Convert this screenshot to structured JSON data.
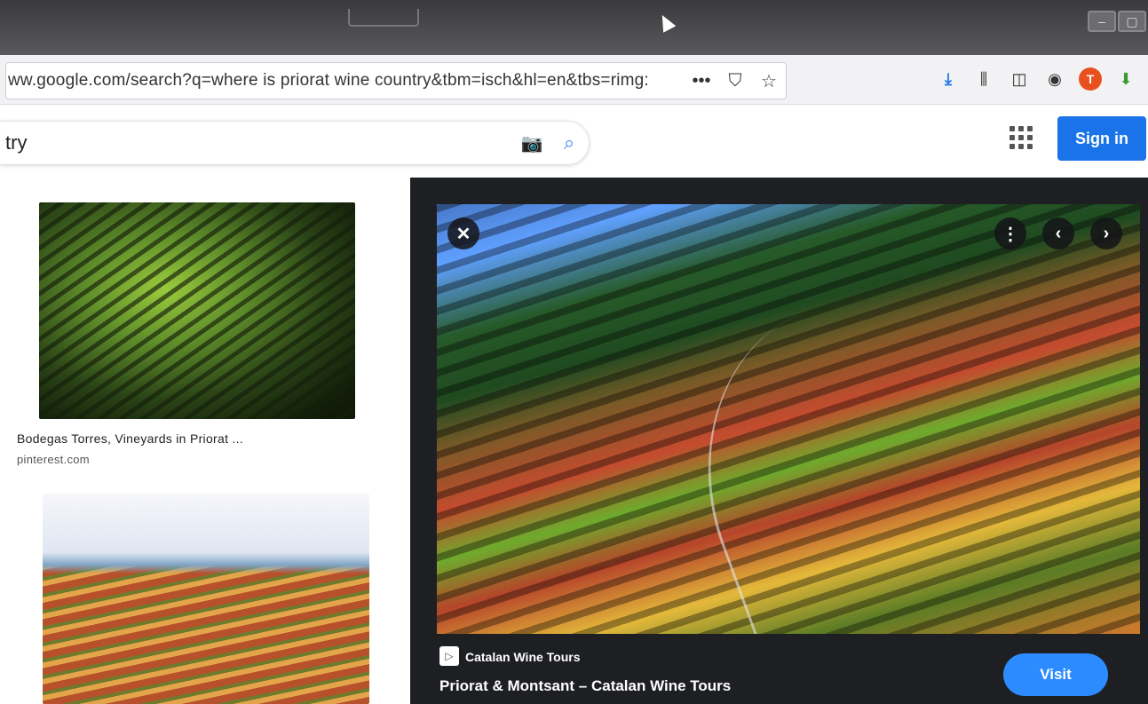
{
  "browser": {
    "url": "ww.google.com/search?q=where is priorat wine country&tbm=isch&hl=en&tbs=rimg:",
    "url_actions": [
      "•••",
      "⛉",
      "☆"
    ],
    "toolbar_icons": [
      "download-icon",
      "library-icon",
      "sidebar-icon",
      "account-icon",
      "extension-t-icon",
      "extension-green-icon"
    ]
  },
  "google": {
    "query": "try",
    "signin_label": "Sign in"
  },
  "results": [
    {
      "title": "Bodegas Torres, Vineyards in Priorat ...",
      "source": "pinterest.com"
    }
  ],
  "preview": {
    "site": "Catalan Wine Tours",
    "title": "Priorat & Montsant – Catalan Wine Tours",
    "visit_label": "Visit"
  },
  "colors": {
    "google_blue": "#1a73e8",
    "visit_blue": "#2c8bff",
    "preview_bg": "#1e1f23"
  }
}
